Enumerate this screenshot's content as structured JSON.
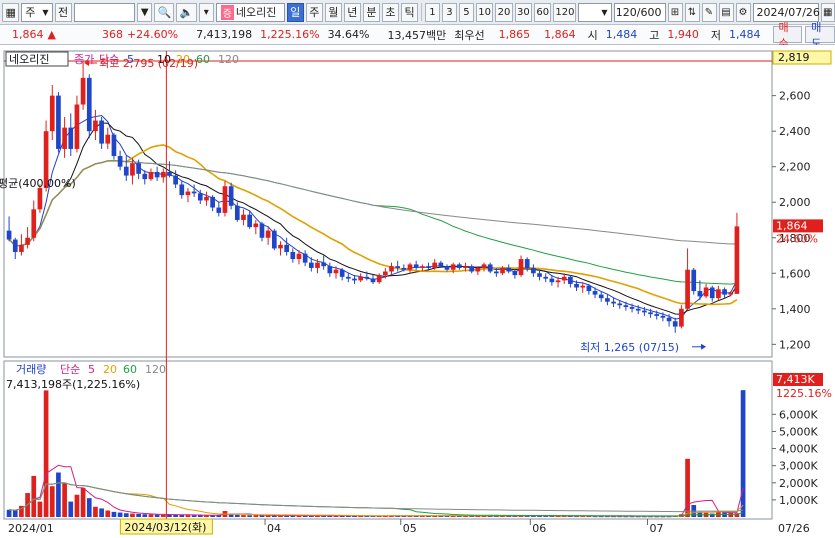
{
  "toolbar": {
    "market": "주",
    "market_options_icon": "chevron-down-icon",
    "type": "전",
    "stock_code": "",
    "stock_tag": "증",
    "stock_name": "네오리진",
    "periods": [
      "일",
      "주",
      "월",
      "년",
      "분",
      "초",
      "틱"
    ],
    "active_period": "일",
    "minute_steps": [
      "1",
      "3",
      "5",
      "10",
      "20",
      "30",
      "60",
      "120"
    ],
    "count_display": "120/600",
    "date": "2024/07/26"
  },
  "quote": {
    "price": "1,864",
    "change": "368",
    "change_pct": "+24.60%",
    "volume": "7,413,198",
    "volume_pct": "1,225.16%",
    "turnover_pct": "34.64%",
    "amount": "13,457백만",
    "best_label": "최우선",
    "best_ask": "1,865",
    "best_bid": "1,864",
    "open_label": "시",
    "open": "1,484",
    "high_label": "고",
    "high": "1,940",
    "low_label": "저",
    "low": "1,484",
    "buy_label": "매수",
    "sell_label": "매도"
  },
  "chart_data": {
    "type": "candlestick",
    "stock_label": "네오리진",
    "price_legend": {
      "title": "종가",
      "method": "단순",
      "periods": [
        "5",
        "10",
        "20",
        "60",
        "120"
      ]
    },
    "volume_legend": {
      "title": "거래량",
      "method": "단순",
      "periods": [
        "5",
        "20",
        "60",
        "120"
      ]
    },
    "price_axis": {
      "ticks": [
        1200,
        1400,
        1600,
        1800,
        2000,
        2200,
        2400,
        2600
      ],
      "ylim": [
        1140,
        2840
      ]
    },
    "volume_axis": {
      "ticks": [
        "1,000K",
        "2,000K",
        "3,000K",
        "4,000K",
        "5,000K",
        "6,000K"
      ],
      "tick_values": [
        1000,
        2000,
        3000,
        4000,
        5000,
        6000
      ],
      "ylim": [
        0,
        9000
      ]
    },
    "x_labels": [
      {
        "label": "2024/01",
        "index": 0
      },
      {
        "label": "04",
        "index": 42
      },
      {
        "label": "05",
        "index": 64
      },
      {
        "label": "06",
        "index": 85
      },
      {
        "label": "07",
        "index": 104
      },
      {
        "label": "07/26",
        "index": 119
      }
    ],
    "crosshair": {
      "date": "2024/03/12(화)",
      "index": 26,
      "price_label": "2,819",
      "price": 2819
    },
    "annotations": {
      "max": {
        "text": "최고 2,795 (02/19)",
        "index": 12,
        "price": 2795
      },
      "min": {
        "text": "최저 1,265 (07/15)",
        "index": 113,
        "price": 1265
      },
      "left_text": "평균(400.00%)",
      "volume_info": "7,413,198주(1,225.16%)"
    },
    "last_price": {
      "value": 1864,
      "label": "1,864",
      "pct": "24.60%"
    },
    "last_volume": {
      "label": "7,413K",
      "pct": "1225.16%"
    },
    "max_hline": 2795,
    "candles": [
      [
        1840,
        1920,
        1780,
        1790
      ],
      [
        1790,
        1800,
        1680,
        1720
      ],
      [
        1720,
        1820,
        1700,
        1760
      ],
      [
        1760,
        1860,
        1740,
        1800
      ],
      [
        1800,
        2010,
        1780,
        1960
      ],
      [
        1960,
        2100,
        1940,
        2080
      ],
      [
        2080,
        2460,
        2060,
        2400
      ],
      [
        2400,
        2660,
        2350,
        2600
      ],
      [
        2600,
        2620,
        2280,
        2300
      ],
      [
        2300,
        2480,
        2250,
        2420
      ],
      [
        2420,
        2500,
        2260,
        2300
      ],
      [
        2300,
        2600,
        2280,
        2550
      ],
      [
        2550,
        2795,
        2520,
        2700
      ],
      [
        2700,
        2720,
        2360,
        2400
      ],
      [
        2400,
        2520,
        2350,
        2460
      ],
      [
        2460,
        2480,
        2300,
        2330
      ],
      [
        2330,
        2420,
        2300,
        2380
      ],
      [
        2380,
        2390,
        2240,
        2260
      ],
      [
        2260,
        2290,
        2180,
        2200
      ],
      [
        2200,
        2260,
        2120,
        2150
      ],
      [
        2150,
        2250,
        2100,
        2220
      ],
      [
        2220,
        2240,
        2130,
        2160
      ],
      [
        2160,
        2180,
        2100,
        2130
      ],
      [
        2130,
        2190,
        2120,
        2170
      ],
      [
        2170,
        2200,
        2120,
        2140
      ],
      [
        2140,
        2190,
        2110,
        2170
      ],
      [
        2170,
        2230,
        2140,
        2150
      ],
      [
        2150,
        2180,
        2080,
        2100
      ],
      [
        2100,
        2120,
        2020,
        2040
      ],
      [
        2040,
        2080,
        2000,
        2060
      ],
      [
        2060,
        2100,
        2030,
        2050
      ],
      [
        2050,
        2070,
        1990,
        2010
      ],
      [
        2010,
        2060,
        1980,
        2030
      ],
      [
        2030,
        2040,
        1950,
        1970
      ],
      [
        1970,
        2000,
        1920,
        1940
      ],
      [
        1940,
        2120,
        1920,
        2090
      ],
      [
        2090,
        2110,
        1960,
        1980
      ],
      [
        1980,
        2000,
        1890,
        1900
      ],
      [
        1900,
        1960,
        1870,
        1930
      ],
      [
        1930,
        1950,
        1850,
        1860
      ],
      [
        1860,
        1900,
        1820,
        1880
      ],
      [
        1880,
        1890,
        1780,
        1800
      ],
      [
        1800,
        1860,
        1760,
        1840
      ],
      [
        1840,
        1850,
        1730,
        1740
      ],
      [
        1740,
        1780,
        1700,
        1760
      ],
      [
        1760,
        1800,
        1700,
        1720
      ],
      [
        1720,
        1740,
        1660,
        1680
      ],
      [
        1680,
        1730,
        1650,
        1710
      ],
      [
        1710,
        1730,
        1640,
        1660
      ],
      [
        1660,
        1690,
        1610,
        1630
      ],
      [
        1630,
        1680,
        1600,
        1660
      ],
      [
        1660,
        1700,
        1620,
        1640
      ],
      [
        1640,
        1660,
        1580,
        1600
      ],
      [
        1600,
        1640,
        1570,
        1620
      ],
      [
        1620,
        1630,
        1560,
        1580
      ],
      [
        1580,
        1600,
        1550,
        1570
      ],
      [
        1570,
        1590,
        1540,
        1560
      ],
      [
        1560,
        1600,
        1550,
        1580
      ],
      [
        1580,
        1610,
        1560,
        1570
      ],
      [
        1570,
        1590,
        1540,
        1550
      ],
      [
        1550,
        1600,
        1540,
        1590
      ],
      [
        1590,
        1630,
        1570,
        1610
      ],
      [
        1610,
        1660,
        1590,
        1640
      ],
      [
        1640,
        1670,
        1610,
        1630
      ],
      [
        1630,
        1650,
        1610,
        1620
      ],
      [
        1620,
        1660,
        1600,
        1650
      ],
      [
        1650,
        1670,
        1620,
        1630
      ],
      [
        1630,
        1650,
        1610,
        1640
      ],
      [
        1640,
        1660,
        1620,
        1630
      ],
      [
        1630,
        1680,
        1620,
        1660
      ],
      [
        1660,
        1670,
        1630,
        1640
      ],
      [
        1640,
        1650,
        1610,
        1620
      ],
      [
        1620,
        1660,
        1600,
        1650
      ],
      [
        1650,
        1660,
        1620,
        1630
      ],
      [
        1630,
        1660,
        1610,
        1640
      ],
      [
        1640,
        1650,
        1600,
        1610
      ],
      [
        1610,
        1640,
        1590,
        1630
      ],
      [
        1630,
        1660,
        1610,
        1650
      ],
      [
        1650,
        1660,
        1600,
        1610
      ],
      [
        1610,
        1630,
        1580,
        1600
      ],
      [
        1600,
        1640,
        1590,
        1630
      ],
      [
        1630,
        1650,
        1600,
        1610
      ],
      [
        1610,
        1620,
        1570,
        1590
      ],
      [
        1590,
        1700,
        1580,
        1680
      ],
      [
        1680,
        1690,
        1610,
        1630
      ],
      [
        1630,
        1650,
        1580,
        1600
      ],
      [
        1600,
        1620,
        1560,
        1580
      ],
      [
        1580,
        1600,
        1550,
        1570
      ],
      [
        1570,
        1590,
        1530,
        1550
      ],
      [
        1550,
        1580,
        1520,
        1560
      ],
      [
        1560,
        1600,
        1540,
        1580
      ],
      [
        1580,
        1590,
        1520,
        1540
      ],
      [
        1540,
        1560,
        1500,
        1520
      ],
      [
        1520,
        1550,
        1490,
        1530
      ],
      [
        1530,
        1540,
        1480,
        1500
      ],
      [
        1500,
        1520,
        1460,
        1480
      ],
      [
        1480,
        1500,
        1440,
        1460
      ],
      [
        1460,
        1480,
        1420,
        1440
      ],
      [
        1440,
        1460,
        1410,
        1430
      ],
      [
        1430,
        1450,
        1400,
        1420
      ],
      [
        1420,
        1440,
        1390,
        1410
      ],
      [
        1410,
        1430,
        1380,
        1400
      ],
      [
        1400,
        1420,
        1370,
        1390
      ],
      [
        1390,
        1410,
        1360,
        1380
      ],
      [
        1380,
        1400,
        1350,
        1370
      ],
      [
        1370,
        1390,
        1340,
        1360
      ],
      [
        1360,
        1380,
        1330,
        1350
      ],
      [
        1350,
        1370,
        1300,
        1330
      ],
      [
        1330,
        1350,
        1265,
        1300
      ],
      [
        1300,
        1420,
        1290,
        1400
      ],
      [
        1400,
        1740,
        1390,
        1620
      ],
      [
        1620,
        1630,
        1480,
        1500
      ],
      [
        1500,
        1560,
        1450,
        1470
      ],
      [
        1470,
        1540,
        1460,
        1520
      ],
      [
        1520,
        1530,
        1440,
        1460
      ],
      [
        1460,
        1530,
        1450,
        1510
      ],
      [
        1510,
        1520,
        1460,
        1480
      ],
      [
        1480,
        1500,
        1470,
        1490
      ],
      [
        1484,
        1940,
        1484,
        1864
      ]
    ],
    "volume_series": {
      "name": "거래량",
      "values": [
        420,
        380,
        650,
        1400,
        2400,
        900,
        7400,
        1800,
        2600,
        2000,
        900,
        1300,
        1700,
        1100,
        600,
        500,
        380,
        300,
        260,
        220,
        200,
        180,
        160,
        150,
        140,
        130,
        150,
        140,
        120,
        110,
        100,
        110,
        100,
        120,
        100,
        350,
        180,
        130,
        110,
        100,
        100,
        90,
        95,
        90,
        85,
        90,
        85,
        80,
        80,
        75,
        80,
        75,
        70,
        70,
        70,
        65,
        65,
        70,
        65,
        60,
        65,
        70,
        80,
        75,
        70,
        75,
        70,
        65,
        70,
        75,
        70,
        65,
        70,
        65,
        70,
        65,
        60,
        65,
        70,
        60,
        60,
        65,
        60,
        120,
        80,
        70,
        65,
        60,
        60,
        60,
        65,
        60,
        55,
        55,
        55,
        50,
        50,
        50,
        48,
        48,
        45,
        45,
        45,
        44,
        44,
        42,
        42,
        45,
        60,
        160,
        3400,
        700,
        300,
        250,
        200,
        300,
        280,
        250,
        220,
        7413
      ]
    }
  }
}
